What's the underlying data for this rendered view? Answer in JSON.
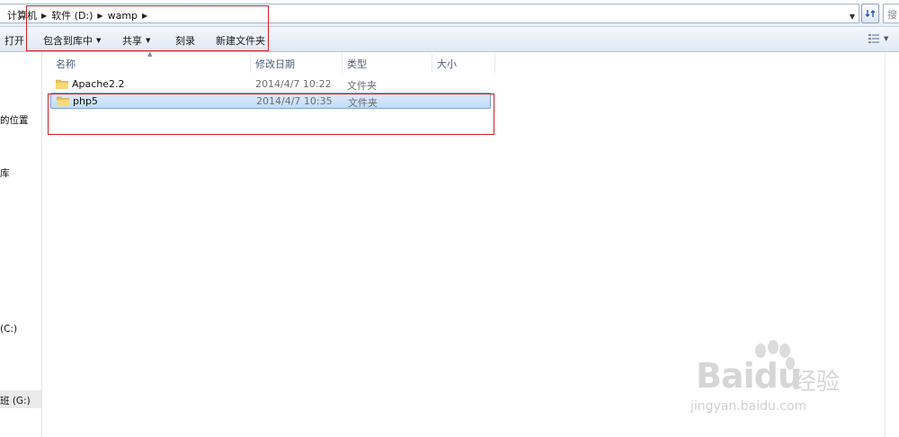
{
  "address": {
    "crumbs": [
      "计算机",
      "软件 (D:)",
      "wamp"
    ],
    "search_placeholder": "搜"
  },
  "toolbar": {
    "open_label": "打开",
    "include_label": "包含到库中",
    "share_label": "共享",
    "burn_label": "刻录",
    "newfolder_label": "新建文件夹"
  },
  "columns": {
    "name": "名称",
    "date": "修改日期",
    "type": "类型",
    "size": "大小"
  },
  "files": [
    {
      "name": "Apache2.2",
      "date": "2014/4/7 10:22",
      "type": "文件夹",
      "size": ""
    },
    {
      "name": "php5",
      "date": "2014/4/7 10:35",
      "type": "文件夹",
      "size": ""
    }
  ],
  "nav": {
    "recent": "的位置",
    "libraries": "库",
    "drive_c": "(C:)",
    "drive_g": "班 (G:)"
  },
  "watermark": {
    "brand": "Bai",
    "brand2": "du",
    "cn": "经验",
    "url": "jingyan.baidu.com"
  },
  "colors": {
    "annotation_red": "#d21d24",
    "selection_blue": "#c1dcfa"
  }
}
